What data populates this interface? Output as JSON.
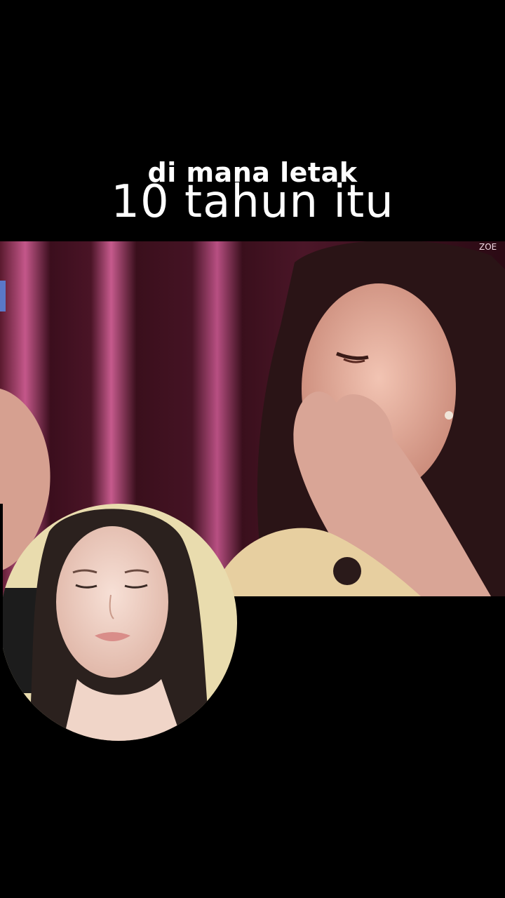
{
  "caption": {
    "line1": "di mana letak",
    "line2": "10 tahun itu"
  },
  "video": {
    "description_icon": "clip-frame",
    "palette": {
      "curtain_dark": "#3a0f1c",
      "curtain_light": "#b34a7a",
      "skin": "#d9a596",
      "hair": "#2a1416"
    }
  },
  "pip": {
    "icon": "reaction-camera",
    "palette": {
      "wall": "#e9dcae",
      "skin": "#efd3c7",
      "hair": "#2b211e"
    }
  }
}
